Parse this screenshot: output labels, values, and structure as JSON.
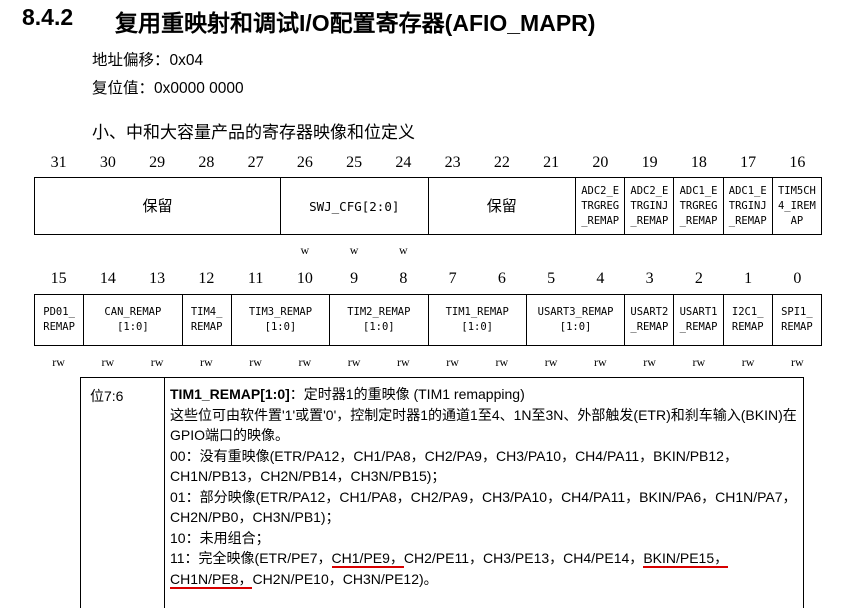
{
  "header": {
    "number": "8.4.2",
    "title": "复用重映射和调试I/O配置寄存器(AFIO_MAPR)"
  },
  "meta": {
    "offset": "地址偏移：0x04",
    "reset": "复位值：0x0000 0000"
  },
  "subheading": "小、中和大容量产品的寄存器映像和位定义",
  "upper_bits": [
    "31",
    "30",
    "29",
    "28",
    "27",
    "26",
    "25",
    "24",
    "23",
    "22",
    "21",
    "20",
    "19",
    "18",
    "17",
    "16"
  ],
  "upper_fields": {
    "reserved1": "保留",
    "swj": "SWJ_CFG[2:0]",
    "reserved2": "保留",
    "adc2_regular": [
      "ADC2_E",
      "TRGREG",
      "_REMAP"
    ],
    "adc2_inj": [
      "ADC2_E",
      "TRGINJ",
      "_REMAP"
    ],
    "adc1_regular": [
      "ADC1_E",
      "TRGREG",
      "_REMAP"
    ],
    "adc1_inj": [
      "ADC1_E",
      "TRGINJ",
      "_REMAP"
    ],
    "tim5": [
      "TIM5CH",
      "4_IREM",
      "AP"
    ]
  },
  "upper_access": [
    "",
    "",
    "",
    "",
    "",
    "w",
    "w",
    "w",
    "",
    "",
    "",
    "",
    "",
    "",
    "",
    ""
  ],
  "lower_bits": [
    "15",
    "14",
    "13",
    "12",
    "11",
    "10",
    "9",
    "8",
    "7",
    "6",
    "5",
    "4",
    "3",
    "2",
    "1",
    "0"
  ],
  "lower_fields": {
    "pd01": [
      "PD01_",
      "REMAP"
    ],
    "can": [
      "CAN_REMAP",
      "[1:0]"
    ],
    "tim4": [
      "TIM4_",
      "REMAP"
    ],
    "tim3": [
      "TIM3_REMAP",
      "[1:0]"
    ],
    "tim2": [
      "TIM2_REMAP",
      "[1:0]"
    ],
    "tim1": [
      "TIM1_REMAP",
      "[1:0]"
    ],
    "usart3": [
      "USART3_REMAP",
      "[1:0]"
    ],
    "usart2": [
      "USART2",
      "_REMAP"
    ],
    "usart1": [
      "USART1",
      "_REMAP"
    ],
    "i2c1": [
      "I2C1_",
      "REMAP"
    ],
    "spi1": [
      "SPI1_",
      "REMAP"
    ]
  },
  "lower_access": [
    "rw",
    "rw",
    "rw",
    "rw",
    "rw",
    "rw",
    "rw",
    "rw",
    "rw",
    "rw",
    "rw",
    "rw",
    "rw",
    "rw",
    "rw",
    "rw"
  ],
  "description": {
    "bits": "位7:6",
    "field": "TIM1_REMAP[1:0]",
    "field_suffix": "：定时器1的重映像 (TIM1 remapping)",
    "summary": "这些位可由软件置'1'或置'0'，控制定时器1的通道1至4、1N至3N、外部触发(ETR)和刹车输入(BKIN)在GPIO端口的映像。",
    "opt00": "00：没有重映像(ETR/PA12，CH1/PA8，CH2/PA9，CH3/PA10，CH4/PA11，BKIN/PB12，CH1N/PB13，CH2N/PB14，CH3N/PB15)；",
    "opt01": "01：部分映像(ETR/PA12，CH1/PA8，CH2/PA9，CH3/PA10，CH4/PA11，BKIN/PA6，CH1N/PA7，CH2N/PB0，CH3N/PB1)；",
    "opt10": "10：未用组合；",
    "opt11_a": "11：完全映像(ETR/PE7，",
    "opt11_ch1": "CH1/PE9，",
    "opt11_b": "CH2/PE11，CH3/PE13，CH4/PE14，",
    "opt11_bkin": "BKIN/PE15，",
    "opt11_ch1n": "CH1N/PE8，",
    "opt11_c": "CH2N/PE10，CH3N/PE12)。"
  }
}
